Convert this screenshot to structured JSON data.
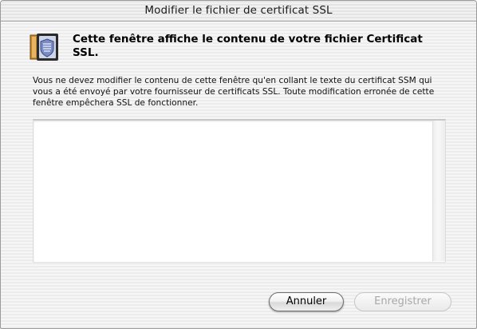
{
  "dialog": {
    "title": "Modifier le fichier de certificat SSL",
    "heading": "Cette fenêtre affiche le contenu de votre fichier Certificat SSL.",
    "description": "Vous ne devez modifier le contenu de cette fenêtre qu'en collant le texte du certificat SSM qui vous a été envoyé par votre fournisseur de certificats SSL. Toute modification erronée de cette fenêtre empêchera SSL de fonctionner.",
    "textarea_value": "",
    "icon": "certificate-document-icon"
  },
  "buttons": {
    "cancel_label": "Annuler",
    "save_label": "Enregistrer",
    "save_enabled": false
  }
}
